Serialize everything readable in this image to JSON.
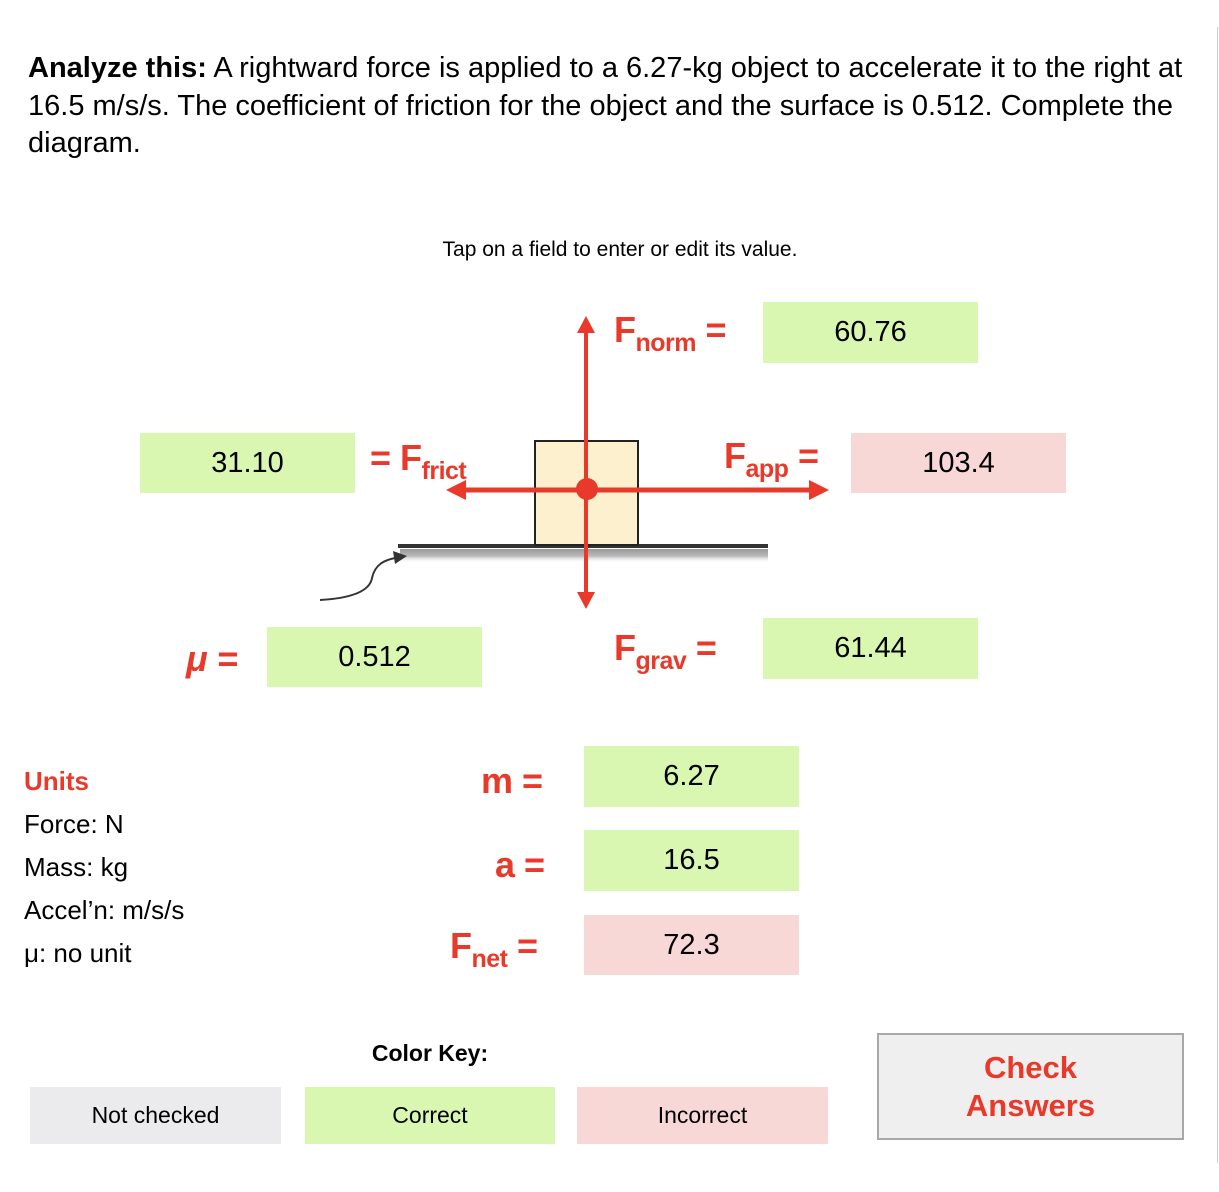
{
  "prompt": {
    "lead": "Analyze this:",
    "text": " A rightward force is applied to a 6.27-kg object to accelerate it to the right at 16.5 m/s/s. The coefficient of friction for the object and the surface is 0.512. Complete the diagram."
  },
  "hint": "Tap on a field to enter or edit its value.",
  "diagram": {
    "labels": {
      "fnorm": {
        "base": "F",
        "sub": "norm",
        "eq": " ="
      },
      "fapp": {
        "base": "F",
        "sub": "app",
        "eq": " ="
      },
      "ffrict": {
        "eq": "= ",
        "base": "F",
        "sub": "frict"
      },
      "fgrav": {
        "base": "F",
        "sub": "grav",
        "eq": " ="
      },
      "mu": "μ =",
      "m": "m =",
      "a": "a =",
      "fnet": {
        "base": "F",
        "sub": "net",
        "eq": " ="
      }
    },
    "fields": {
      "fnorm": {
        "value": "60.76",
        "status": "correct"
      },
      "fapp": {
        "value": "103.4",
        "status": "incorrect"
      },
      "ffrict": {
        "value": "31.10",
        "status": "correct"
      },
      "fgrav": {
        "value": "61.44",
        "status": "correct"
      },
      "mu": {
        "value": "0.512",
        "status": "correct"
      },
      "m": {
        "value": "6.27",
        "status": "correct"
      },
      "a": {
        "value": "16.5",
        "status": "correct"
      },
      "fnet": {
        "value": "72.3",
        "status": "incorrect"
      }
    },
    "colors": {
      "arrow": "#e8392a",
      "box_fill": "#fcf0cf",
      "surface": "#333333"
    }
  },
  "units": {
    "title": "Units",
    "items": [
      "Force: N",
      "Mass: kg",
      "Accel’n: m/s/s",
      "μ: no unit"
    ]
  },
  "color_key": {
    "title": "Color Key:",
    "items": [
      {
        "label": "Not checked",
        "color": "#ebebed"
      },
      {
        "label": "Correct",
        "color": "#daf7b1"
      },
      {
        "label": "Incorrect",
        "color": "#f8d7d7"
      }
    ]
  },
  "check_button": {
    "line1": "Check",
    "line2": "Answers"
  }
}
